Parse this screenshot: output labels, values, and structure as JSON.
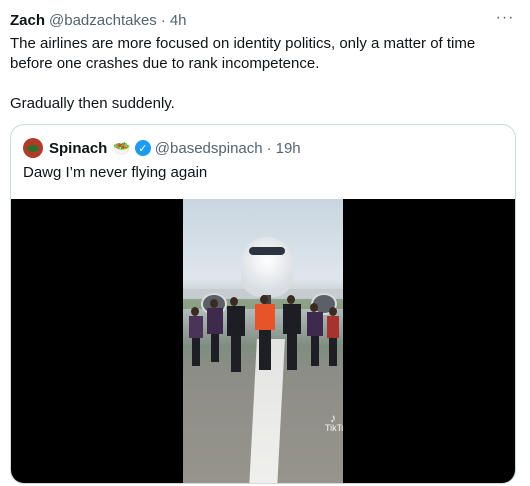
{
  "tweet": {
    "author_name": "Zach",
    "author_handle": "@badzachtakes",
    "separator": "·",
    "time": "4h",
    "more_icon": "···",
    "paragraph1": "The airlines are more focused on identity politics, only a matter of time before one crashes due to rank incompetence.",
    "paragraph2": "Gradually then suddenly."
  },
  "quote": {
    "author_name": "Spinach",
    "emoji": "🥗",
    "verified_mark": "✓",
    "author_handle": "@basedspinach",
    "separator": "·",
    "time": "19h",
    "text": "Dawg I’m never flying again"
  },
  "video": {
    "watermark_label": "TikTok"
  },
  "colors": {
    "text_primary": "#0f1419",
    "text_secondary": "#536471",
    "border": "#cfd9de",
    "verified_blue": "#1d9bf0"
  }
}
